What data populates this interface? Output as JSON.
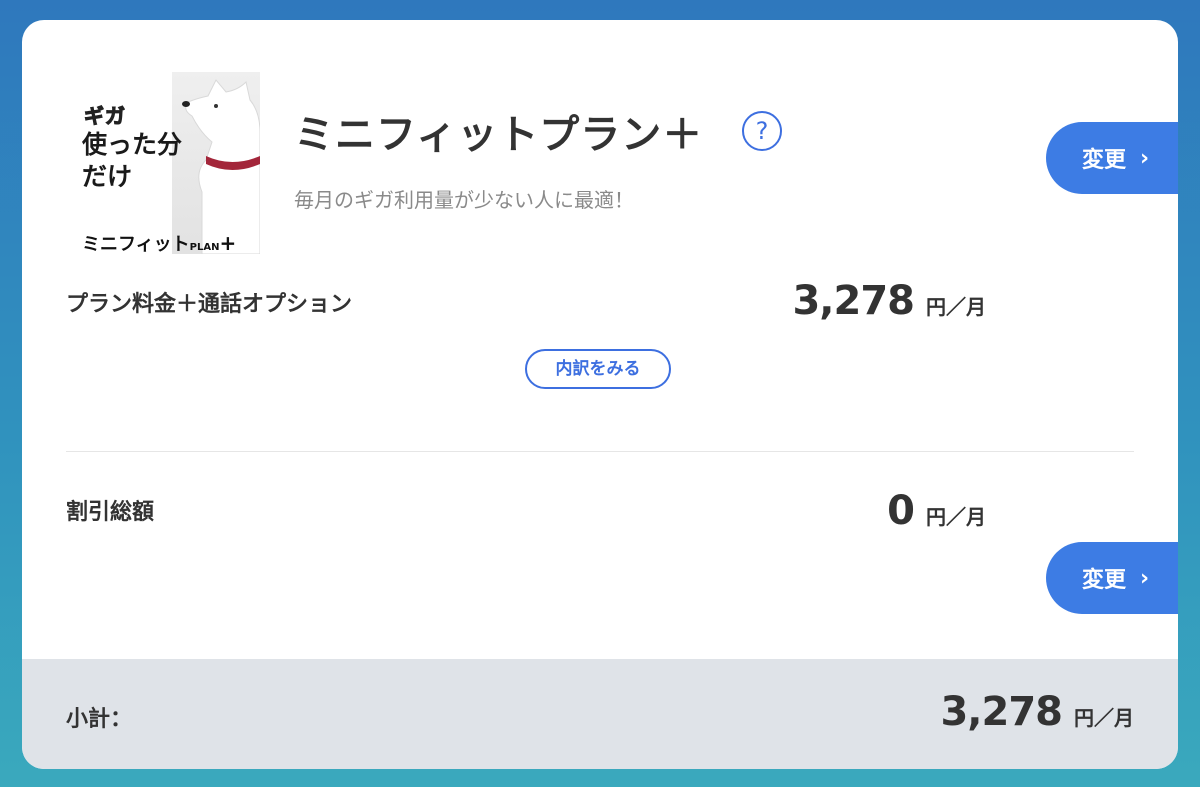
{
  "plan": {
    "image": {
      "giga": "ギガ",
      "line1": "使った分",
      "line2": "だけ",
      "brand": "ミニフィット",
      "brand_plan": "PLAN",
      "brand_plus": "+"
    },
    "title": "ミニフィットプラン＋",
    "help_icon": "?",
    "subtitle": "毎月のギガ利用量が少ない人に最適！",
    "change_label": "変更",
    "change_icon": "chevron-right-icon"
  },
  "fee": {
    "label": "プラン料金＋通話オプション",
    "amount": "3,278",
    "unit": "円／月",
    "detail_button": "内訳をみる"
  },
  "discount": {
    "label": "割引総額",
    "amount": "0",
    "unit": "円／月",
    "change_label": "変更"
  },
  "subtotal": {
    "label": "小計：",
    "amount": "3,278",
    "unit": "円／月"
  },
  "chevron": "›",
  "colors": {
    "accent": "#3d7ce4",
    "text": "#333333",
    "subtotal_bg": "#dfe3e8"
  }
}
